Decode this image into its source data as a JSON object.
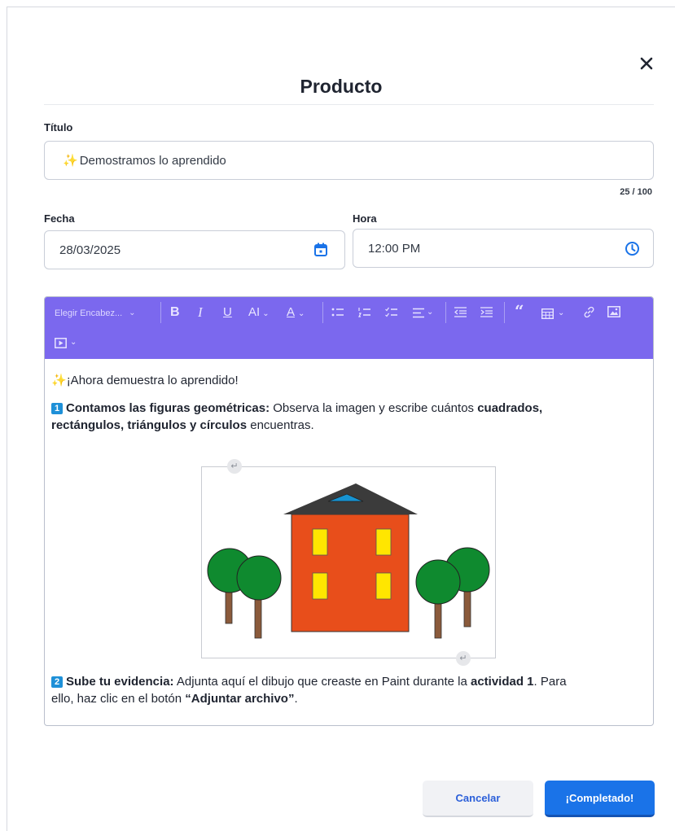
{
  "modal": {
    "title": "Producto",
    "close_icon": "close-icon"
  },
  "form": {
    "title_label": "Título",
    "title_value": "Demostramos lo aprendido",
    "title_emoji": "✨",
    "title_counter": "25 / 100",
    "date_label": "Fecha",
    "date_value": "28/03/2025",
    "time_label": "Hora",
    "time_value": "12:00 PM"
  },
  "toolbar": {
    "heading_select": "Elegir Encabez...",
    "accent_color": "#7b68ee",
    "icons": [
      "chevron-down-icon",
      "bold-icon",
      "italic-icon",
      "underline-icon",
      "font-size-icon",
      "font-color-icon",
      "bullet-list-icon",
      "numbered-list-icon",
      "check-list-icon",
      "align-icon",
      "outdent-icon",
      "indent-icon",
      "quote-icon",
      "table-icon",
      "link-icon",
      "image-icon",
      "video-icon"
    ]
  },
  "content": {
    "intro_emoji": "✨",
    "intro": "¡Ahora demuestra lo aprendido!",
    "item1_number": "1",
    "item1_bold": "Contamos las figuras geométricas:",
    "item1_text_a": " Observa la imagen y escribe cuántos ",
    "item1_bold_b": "cuadrados,",
    "item1_bold_c": "rectángulos, triángulos y círculos",
    "item1_text_d": " encuentras.",
    "item2_number": "2",
    "item2_bold": "Sube tu evidencia:",
    "item2_text_a": " Adjunta aquí el dibujo que creaste en Paint durante la ",
    "item2_bold_b": "actividad 1",
    "item2_text_c": ". Para",
    "item2_text_d": "ello, haz clic en el botón ",
    "item2_bold_e": "“Adjuntar archivo”",
    "item2_text_f": "."
  },
  "footer": {
    "cancel_label": "Cancelar",
    "ok_label": "¡Completado!",
    "primary_color": "#1a73e8"
  }
}
